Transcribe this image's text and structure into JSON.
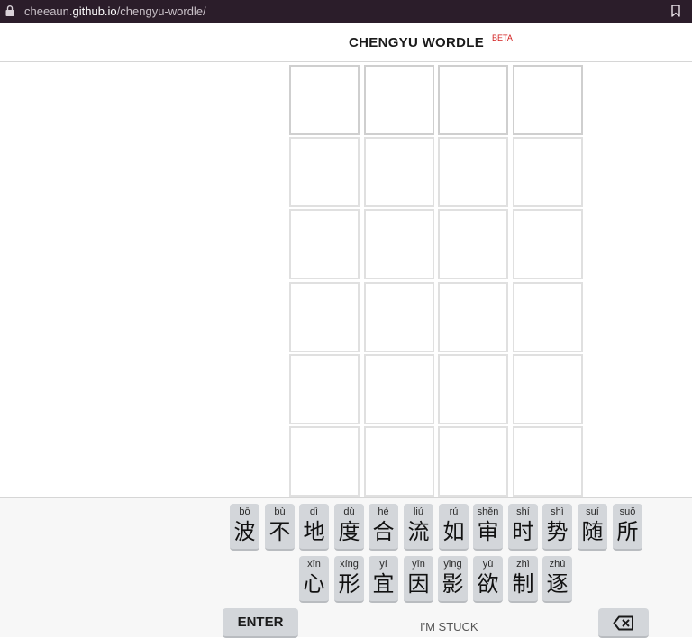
{
  "browser": {
    "url_prefix": "cheeaun.",
    "url_host": "github.io",
    "url_path": "/chengyu-wordle/"
  },
  "header": {
    "title": "CHENGYU WORDLE",
    "badge": "BETA"
  },
  "grid": {
    "rows": 6,
    "cols": 4
  },
  "keyboard": {
    "row1": [
      {
        "pinyin": "bō",
        "char": "波"
      },
      {
        "pinyin": "bù",
        "char": "不"
      },
      {
        "pinyin": "dì",
        "char": "地"
      },
      {
        "pinyin": "dù",
        "char": "度"
      },
      {
        "pinyin": "hé",
        "char": "合"
      },
      {
        "pinyin": "liú",
        "char": "流"
      },
      {
        "pinyin": "rú",
        "char": "如"
      },
      {
        "pinyin": "shěn",
        "char": "审"
      },
      {
        "pinyin": "shí",
        "char": "时"
      },
      {
        "pinyin": "shì",
        "char": "势"
      },
      {
        "pinyin": "suí",
        "char": "随"
      },
      {
        "pinyin": "suǒ",
        "char": "所"
      }
    ],
    "row2": [
      {
        "pinyin": "xīn",
        "char": "心"
      },
      {
        "pinyin": "xíng",
        "char": "形"
      },
      {
        "pinyin": "yí",
        "char": "宜"
      },
      {
        "pinyin": "yīn",
        "char": "因"
      },
      {
        "pinyin": "yǐng",
        "char": "影"
      },
      {
        "pinyin": "yù",
        "char": "欲"
      },
      {
        "pinyin": "zhì",
        "char": "制"
      },
      {
        "pinyin": "zhú",
        "char": "逐"
      }
    ],
    "enter_label": "ENTER",
    "stuck_label": "I'M STUCK"
  }
}
